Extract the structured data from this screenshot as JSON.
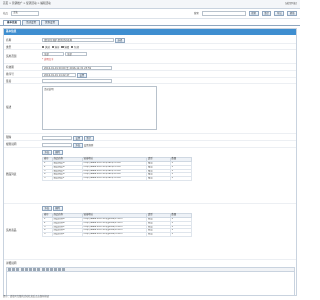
{
  "topbar": {
    "breadcrumb": "首页 > 营销推广 > 促销活动 > 编辑活动",
    "right_text": "[返回列表]"
  },
  "toolbar": {
    "site_label": "站点",
    "site_value": "主站",
    "search_label": "搜索",
    "buttons": [
      "搜索",
      "清空",
      "导出",
      "帮助"
    ]
  },
  "tabs": [
    {
      "label": "基本信息",
      "active": true
    },
    {
      "label": "活动设置",
      "active": false
    },
    {
      "label": "优惠设置",
      "active": false
    }
  ],
  "form": {
    "section_title": "基本信息",
    "rows": {
      "name": {
        "label": "名称",
        "value": "[促销]主图片促销活动名称",
        "button": "选择"
      },
      "type": {
        "label": "类型",
        "options": [
          "满减",
          "满折",
          "满赠",
          "包邮"
        ]
      },
      "scope": {
        "label": "适用范围",
        "select1": "全部",
        "select2": "全部",
        "note": "* 说明文字"
      },
      "time": {
        "label": "有效期",
        "value": "2016-01-01 00:00 至 2016-12-31 23:59"
      },
      "order": {
        "label": "排序号",
        "value": "2016-01-01 14:22:47",
        "button": "设置"
      },
      "link": {
        "label": "链接",
        "value": ""
      },
      "desc": {
        "label": "描述",
        "value": "活动说明"
      },
      "limit": {
        "label": "限购",
        "button1": "设置",
        "button2": "清空"
      },
      "rule": {
        "label": "规则说明",
        "note": "设置规则",
        "btn": "添加"
      }
    },
    "gift_section": {
      "label": "赠品列表",
      "add_button": "添加",
      "del_button": "删除",
      "columns": [
        "编号",
        "商品名称",
        "链接地址",
        "类型",
        "数量"
      ],
      "rows": [
        {
          "no": "1",
          "name": "赠品商品A",
          "url": "http://www.xxx.com/item/1.html",
          "type": "赠品",
          "qty": "1"
        },
        {
          "no": "2",
          "name": "赠品商品B",
          "url": "http://www.xxx.com/item/2.html",
          "type": "赠品",
          "qty": "1"
        },
        {
          "no": "3",
          "name": "赠品商品C",
          "url": "http://www.xxx.com/item/3.html",
          "type": "赠品",
          "qty": "1"
        },
        {
          "no": "4",
          "name": "赠品商品D",
          "url": "http://www.xxx.com/item/4.html",
          "type": "赠品",
          "qty": "1"
        },
        {
          "no": "5",
          "name": "赠品商品E",
          "url": "http://www.xxx.com/item/5.html",
          "type": "赠品",
          "qty": "1"
        }
      ]
    },
    "product_section": {
      "label": "适用商品",
      "add_button": "添加",
      "del_button": "删除",
      "columns": [
        "编号",
        "商品名称",
        "链接地址",
        "类型",
        "数量"
      ],
      "rows": [
        {
          "no": "1",
          "name": "商品名称A",
          "url": "http://www.xxx.com/goods/1.html",
          "type": "商品",
          "qty": "1"
        },
        {
          "no": "2",
          "name": "商品名称B",
          "url": "http://www.xxx.com/goods/2.html",
          "type": "商品",
          "qty": "1"
        },
        {
          "no": "3",
          "name": "商品名称C",
          "url": "http://www.xxx.com/goods/3.html",
          "type": "商品",
          "qty": "1"
        },
        {
          "no": "4",
          "name": "商品名称D",
          "url": "http://www.xxx.com/goods/4.html",
          "type": "商品",
          "qty": "1"
        },
        {
          "no": "5",
          "name": "商品名称E",
          "url": "http://www.xxx.com/goods/5.html",
          "type": "商品",
          "qty": "1"
        }
      ]
    },
    "editor": {
      "label": "详细说明"
    },
    "bottom": "提示：请填写完整的活动信息后点击保存按钮"
  }
}
